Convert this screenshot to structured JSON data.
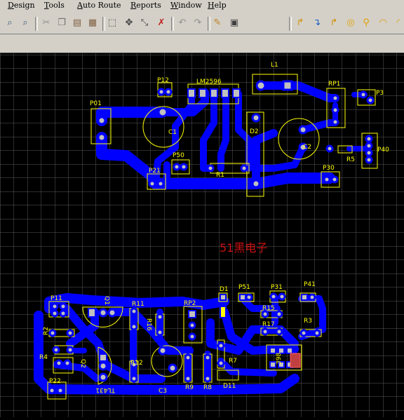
{
  "menu": [
    {
      "label": "esign",
      "accel": "D"
    },
    {
      "label": "ools",
      "accel": "T"
    },
    {
      "label": "uto Route",
      "accel": "A"
    },
    {
      "label": "eports",
      "accel": "R"
    },
    {
      "label": "indow",
      "accel": "W"
    },
    {
      "label": "elp",
      "accel": "H"
    }
  ],
  "toolbar": {
    "icons": [
      "zoom-fit-icon",
      "zoom-area-icon",
      "cut-icon",
      "copy-icon",
      "paste-icon",
      "paste-special-icon",
      "select-icon",
      "move-icon",
      "deselect-icon",
      "cancel-icon",
      "undo-icon",
      "redo-icon",
      "highlight-icon",
      "inspect-icon",
      "track-icon",
      "route-icon",
      "via-icon",
      "pad-icon",
      "arc-icon",
      "arc-center-icon"
    ]
  },
  "colors": {
    "track": "#0000ff",
    "silk": "#ffff00",
    "grid": "#606060",
    "background": "#000000",
    "watermark": "#cc1010"
  },
  "watermark": "51黑电子",
  "components": {
    "top": [
      "P12",
      "LM2596",
      "L1",
      "RP1",
      "P3",
      "P01",
      "C1",
      "D2",
      "C2",
      "P50",
      "R1",
      "P40",
      "R5",
      "P21",
      "P30"
    ],
    "bottom": [
      "D1",
      "P51",
      "P31",
      "P41",
      "P11",
      "Q1",
      "R11",
      "RP2",
      "R15",
      "R2",
      "R16",
      "R17",
      "R3",
      "R4",
      "Q2",
      "R12",
      "C3",
      "R7",
      "R9",
      "R8",
      "D11",
      "P22",
      "TL431",
      "398"
    ]
  }
}
